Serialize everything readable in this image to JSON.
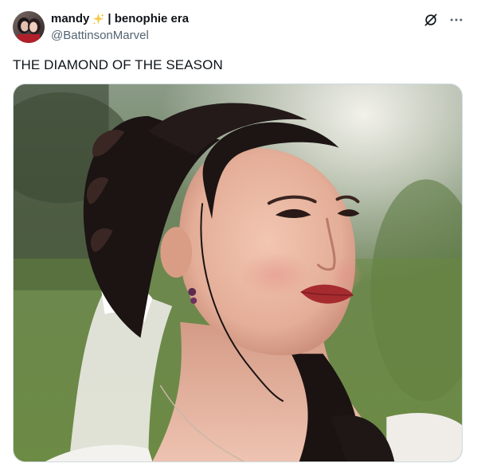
{
  "tweet": {
    "author": {
      "display_name_part1": "mandy",
      "display_name_emoji": "sparkles-emoji",
      "display_name_part2": "| benophie era",
      "handle": "@BattinsonMarvel",
      "avatar_icon": "avatar-photo"
    },
    "text": "THE DIAMOND OF THE SEASON",
    "media": {
      "type": "photo",
      "icon": "photo-bride-looking-up"
    },
    "actions": {
      "grok_icon": "grok-icon",
      "more_icon": "more-dots-icon"
    }
  },
  "colors": {
    "text_primary": "#0f1419",
    "text_secondary": "#536471",
    "sparkle": "#f7c948",
    "border": "#cfd9de"
  }
}
